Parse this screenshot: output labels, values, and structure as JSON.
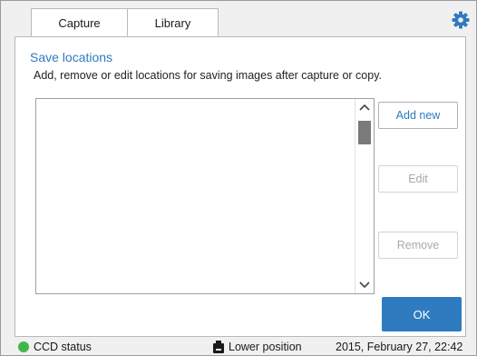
{
  "tabs": {
    "capture": "Capture",
    "library": "Library"
  },
  "icons": {
    "settings": "gear-icon",
    "scroll_up": "chevron-up-icon",
    "scroll_down": "chevron-down-icon",
    "status": "status-dot-icon",
    "position": "camera-icon"
  },
  "panel": {
    "title": "Save locations",
    "description": "Add, remove or edit locations for saving images after capture or copy.",
    "locations": []
  },
  "buttons": {
    "add_new": "Add new",
    "edit": "Edit",
    "remove": "Remove",
    "ok": "OK"
  },
  "status": {
    "ccd": "CCD status",
    "position": "Lower position",
    "datetime": "2015, February 27, 22:42"
  },
  "colors": {
    "accent": "#2f7bbf",
    "status_ok": "#3fb84a",
    "disabled_text": "#a9a9a9"
  }
}
